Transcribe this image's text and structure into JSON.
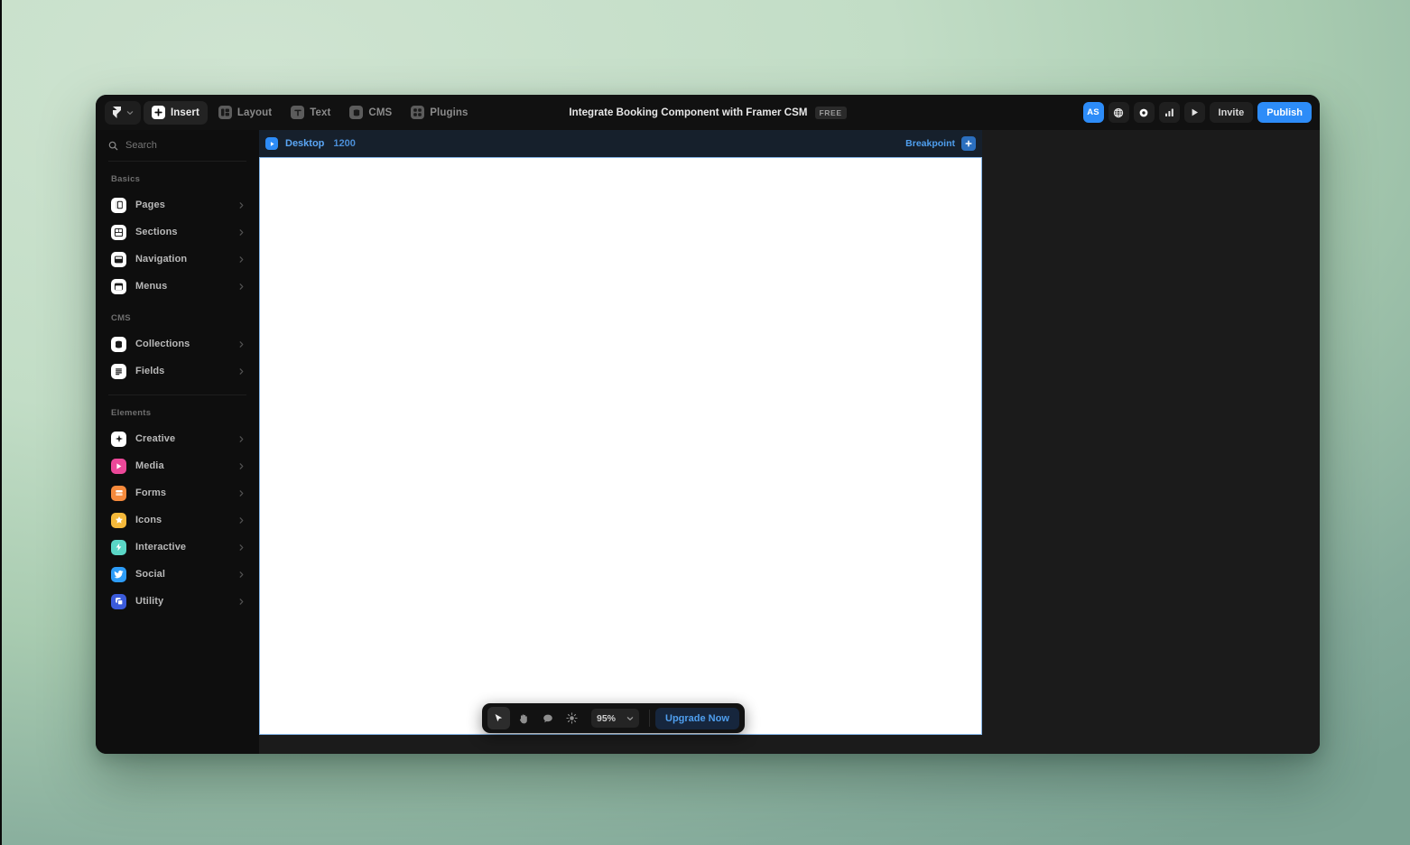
{
  "theme": {
    "accent_blue": "#2d8cf8",
    "window_bg": "#0d0d0d",
    "sidebar_bg": "#0e0e0e",
    "canvas_bg": "#1b1b1b",
    "desktop_bg": "#c2ddc6"
  },
  "toolbar": {
    "logo_name": "framer-logo",
    "items": [
      {
        "label": "Insert",
        "icon": "plus-icon",
        "active": true
      },
      {
        "label": "Layout",
        "icon": "layout-icon",
        "active": false
      },
      {
        "label": "Text",
        "icon": "text-icon",
        "active": false
      },
      {
        "label": "CMS",
        "icon": "cms-icon",
        "active": false
      },
      {
        "label": "Plugins",
        "icon": "plugins-grid-icon",
        "active": false
      }
    ],
    "document_title": "Integrate Booking Component with Framer CSM",
    "plan_badge": "FREE",
    "avatar_initials": "AS",
    "right_icons": [
      {
        "name": "globe-icon"
      },
      {
        "name": "settings-aperture-icon"
      },
      {
        "name": "analytics-bar-chart-icon"
      },
      {
        "name": "preview-play-icon"
      }
    ],
    "invite_label": "Invite",
    "publish_label": "Publish"
  },
  "sidebar": {
    "search": {
      "placeholder": "Search",
      "value": "",
      "icon": "search-icon"
    },
    "sections": [
      {
        "label": "Basics",
        "items": [
          {
            "label": "Pages",
            "icon": "pages-icon",
            "color": "#ffffff"
          },
          {
            "label": "Sections",
            "icon": "sections-icon",
            "color": "#ffffff"
          },
          {
            "label": "Navigation",
            "icon": "navigation-icon",
            "color": "#ffffff"
          },
          {
            "label": "Menus",
            "icon": "menus-icon",
            "color": "#ffffff"
          }
        ]
      },
      {
        "label": "CMS",
        "items": [
          {
            "label": "Collections",
            "icon": "collections-icon",
            "color": "#ffffff"
          },
          {
            "label": "Fields",
            "icon": "fields-icon",
            "color": "#ffffff"
          }
        ]
      },
      {
        "label": "Elements",
        "items": [
          {
            "label": "Creative",
            "icon": "creative-sparkle-icon",
            "color": "#ffffff"
          },
          {
            "label": "Media",
            "icon": "media-play-icon",
            "color": "#ec4899"
          },
          {
            "label": "Forms",
            "icon": "forms-icon",
            "color": "#f68a3c"
          },
          {
            "label": "Icons",
            "icon": "icons-star-icon",
            "color": "#f5b93a"
          },
          {
            "label": "Interactive",
            "icon": "interactive-bolt-icon",
            "color": "#5ad6c6"
          },
          {
            "label": "Social",
            "icon": "social-bird-icon",
            "color": "#2d9cf8"
          },
          {
            "label": "Utility",
            "icon": "utility-copy-icon",
            "color": "#3b5bdb"
          }
        ]
      }
    ]
  },
  "canvas": {
    "breakpoint": {
      "badge_icon": "breakpoint-play-icon",
      "name": "Desktop",
      "width": "1200",
      "add_label": "Breakpoint",
      "add_icon": "plus-icon"
    }
  },
  "floating_toolbar": {
    "tools": [
      {
        "name": "cursor-tool",
        "icon": "cursor-icon",
        "selected": true
      },
      {
        "name": "hand-tool",
        "icon": "hand-icon",
        "selected": false
      },
      {
        "name": "comment-tool",
        "icon": "comment-icon",
        "selected": false
      },
      {
        "name": "appearance-tool",
        "icon": "brightness-icon",
        "selected": false
      }
    ],
    "zoom_value": "95%",
    "zoom_chevron": "chevron-down-icon",
    "upgrade_label": "Upgrade Now"
  }
}
